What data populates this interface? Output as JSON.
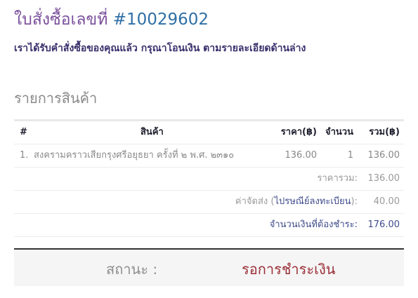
{
  "order": {
    "title_label": "ใบสั่งซื้อเลขที่",
    "order_number": "#10029602",
    "message": "เราได้รับคำสั่งซื้อของคุณแล้ว กรุณาโอนเงิน ตามรายละเอียดด้านล่าง"
  },
  "items_section": {
    "title": "รายการสินค้า",
    "headers": {
      "no": "#",
      "product": "สินค้า",
      "price": "ราคา(฿)",
      "quantity": "จำนวน",
      "total": "รวม(฿)"
    },
    "items": [
      {
        "no": "1.",
        "name": "สงครามคราวเสียกรุงศรีอยุธยา ครั้งที่ ๒ พ.ศ. ๒๓๑๐",
        "price": "136.00",
        "quantity": "1",
        "total": "136.00"
      }
    ]
  },
  "summary": {
    "subtotal_label": "ราคารวม:",
    "subtotal_value": "136.00",
    "shipping_label_prefix": "ค่าจัดส่ง (",
    "shipping_method": "ไปรษณีย์ลงทะเบียน",
    "shipping_label_suffix": "):",
    "shipping_value": "40.00",
    "amount_due_label": "จำนวนเงินที่ต้องชำระ:",
    "amount_due_value": "176.00"
  },
  "status": {
    "label": "สถานะ :",
    "value": "รอการชำระเงิน"
  }
}
